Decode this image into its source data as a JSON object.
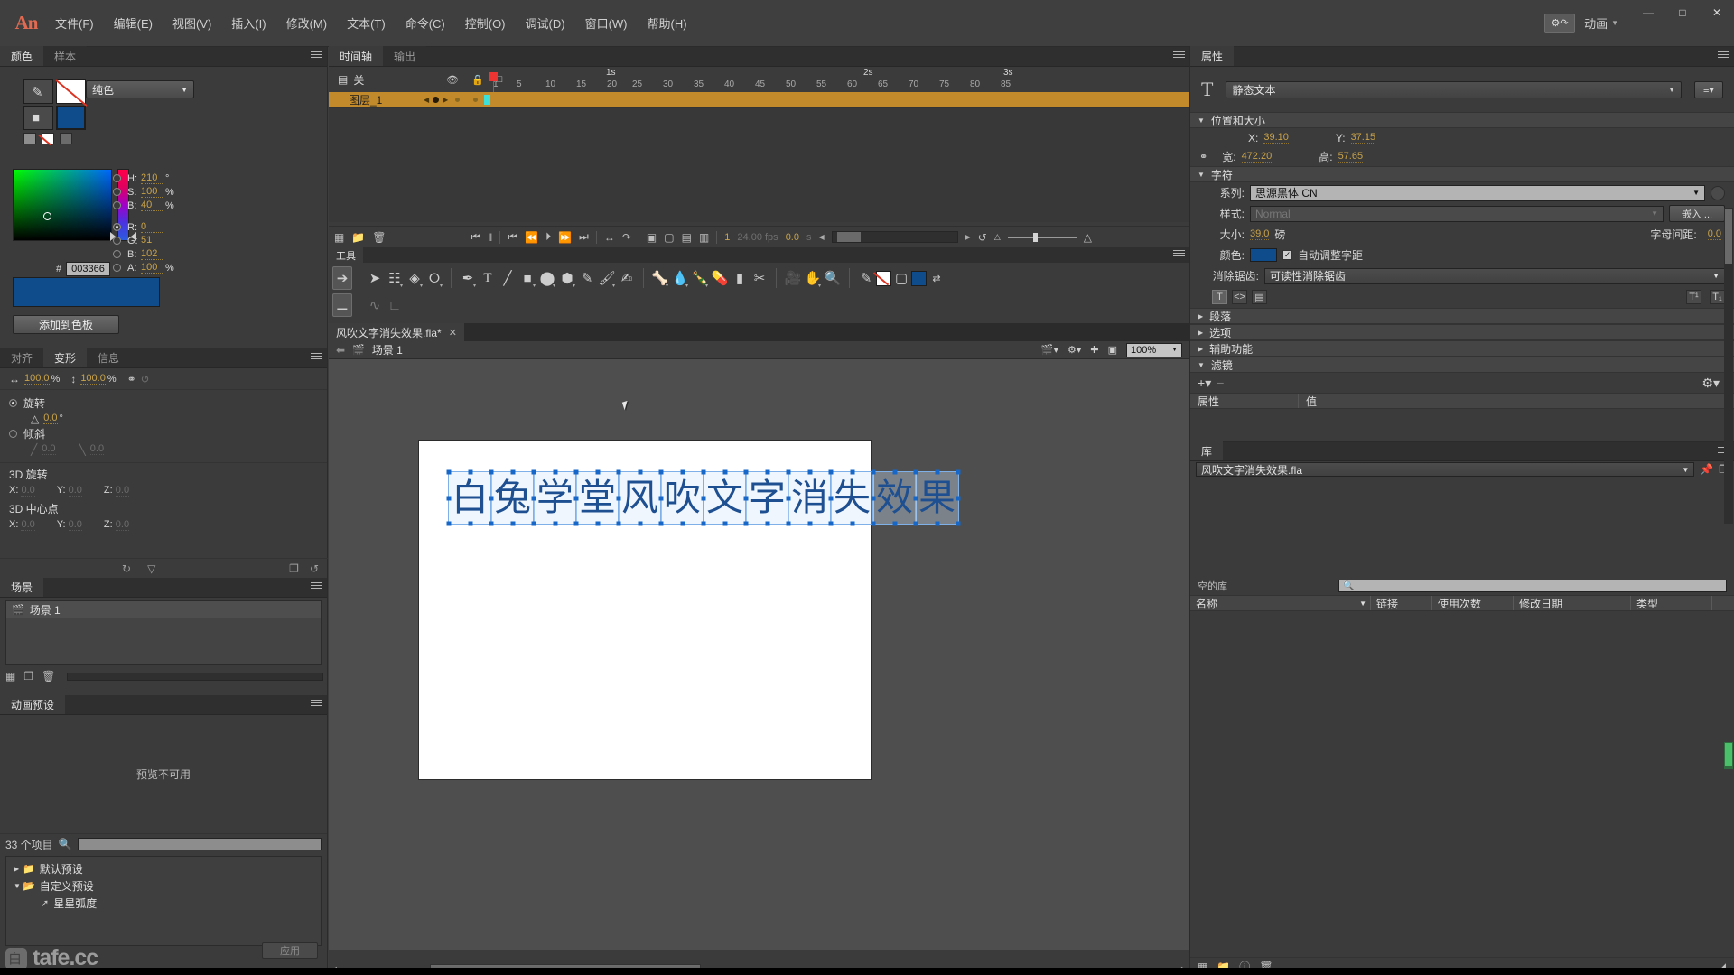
{
  "app": {
    "logo": "An",
    "menus": [
      "文件(F)",
      "编辑(E)",
      "视图(V)",
      "插入(I)",
      "修改(M)",
      "文本(T)",
      "命令(C)",
      "控制(O)",
      "调试(D)",
      "窗口(W)",
      "帮助(H)"
    ],
    "workspace_label": "动画",
    "workspace_icon": "sync-settings-icon",
    "window_buttons": {
      "minimize": "—",
      "maximize": "□",
      "close": "✕"
    }
  },
  "color_panel": {
    "tabs": [
      {
        "label": "颜色",
        "active": true
      },
      {
        "label": "样本",
        "active": false
      }
    ],
    "fill_type": "纯色",
    "hex": "003366",
    "hex_prefix": "#",
    "fields": [
      {
        "label": "H:",
        "value": "210",
        "unit": "°",
        "selected": false
      },
      {
        "label": "S:",
        "value": "100",
        "unit": "%",
        "selected": false
      },
      {
        "label": "B:",
        "value": "40",
        "unit": "%",
        "selected": false
      },
      {
        "label": "R:",
        "value": "0",
        "unit": "",
        "selected": true
      },
      {
        "label": "G:",
        "value": "51",
        "unit": "",
        "selected": false
      },
      {
        "label": "B:",
        "value": "102",
        "unit": "",
        "selected": false
      },
      {
        "label": "A:",
        "value": "100",
        "unit": "%",
        "selected": false
      }
    ],
    "add_swatch_button": "添加到色板",
    "current_color": "#0e4c8c"
  },
  "transform_panel": {
    "tabs": [
      {
        "label": "对齐",
        "active": false
      },
      {
        "label": "变形",
        "active": true
      },
      {
        "label": "信息",
        "active": false
      }
    ],
    "scale_w": "100.0",
    "scale_h": "100.0",
    "pct": "%",
    "rotate_label": "旋转",
    "rotate_value": "0.0",
    "rotate_unit": "°",
    "skew_label": "倾斜",
    "skew_x": "0.0",
    "skew_y": "0.0",
    "rot3d_label": "3D 旋转",
    "rot3d": {
      "x": "0.0",
      "y": "0.0",
      "z": "0.0"
    },
    "center3d_label": "3D 中心点",
    "center3d": {
      "x": "0.0",
      "y": "0.0",
      "z": "0.0"
    },
    "axis_labels": {
      "x": "X:",
      "y": "Y:",
      "z": "Z:"
    }
  },
  "scene_panel": {
    "tab": "场景",
    "items": [
      {
        "label": "场景 1",
        "selected": true
      }
    ]
  },
  "preset_panel": {
    "tab": "动画预设",
    "preview_text": "预览不可用",
    "item_count": "33 个项目",
    "search_placeholder": "",
    "tree": [
      {
        "label": "默认预设",
        "type": "folder",
        "expanded": false,
        "indent": 0
      },
      {
        "label": "自定义预设",
        "type": "folder",
        "expanded": true,
        "indent": 0
      },
      {
        "label": "星星弧度",
        "type": "preset",
        "indent": 1
      }
    ],
    "apply_button": "应用",
    "watermark": "tafe.cc"
  },
  "timeline": {
    "tabs": [
      {
        "label": "时间轴",
        "active": true
      },
      {
        "label": "输出",
        "active": false
      }
    ],
    "onion_label": "关",
    "ruler_seconds": [
      {
        "label": "1s",
        "frame": 24
      },
      {
        "label": "2s",
        "frame": 48
      },
      {
        "label": "3s",
        "frame": 72
      }
    ],
    "ruler_numbers": [
      1,
      5,
      10,
      15,
      20,
      25,
      30,
      35,
      40,
      45,
      50,
      55,
      60,
      65,
      70,
      75,
      80,
      85
    ],
    "layers": [
      {
        "name": "图层_1",
        "selected": true
      }
    ],
    "playhead_frame": 1,
    "current_frame": "1",
    "fps": "24.00 fps",
    "elapsed": "0.0",
    "elapsed_unit": "s"
  },
  "tools": {
    "tab": "工具",
    "selected_tool": "selection-tool",
    "items": [
      "selection-tool",
      "subselection-tool",
      "free-transform-tool",
      "lasso-tool",
      "pen-tool",
      "text-tool",
      "line-tool",
      "rectangle-tool",
      "oval-tool",
      "polystar-tool",
      "pencil-tool",
      "brush-tool",
      "paint-brush-tool",
      "bone-tool",
      "paint-bucket-tool",
      "ink-bottle-tool",
      "eyedropper-tool",
      "eraser-tool",
      "width-tool",
      "camera-tool",
      "hand-tool",
      "zoom-tool"
    ],
    "stroke_color": "#ffffff",
    "fill_color": "#0e4c8c"
  },
  "document": {
    "tab_name": "风吹文字消失效果.fla*",
    "close_glyph": "✕",
    "breadcrumb": "场景 1",
    "zoom": "100%"
  },
  "stage": {
    "characters": [
      "白",
      "兔",
      "学",
      "堂",
      "风",
      "吹",
      "文",
      "字",
      "消",
      "失",
      "效",
      "果"
    ],
    "text_color": "#1d4f91",
    "background": "#ffffff"
  },
  "properties": {
    "tab": "属性",
    "object_type": "静态文本",
    "sections": {
      "position": {
        "title": "位置和大小",
        "x_label": "X:",
        "x_value": "39.10",
        "y_label": "Y:",
        "y_value": "37.15",
        "w_label": "宽:",
        "w_value": "472.20",
        "h_label": "高:",
        "h_value": "57.65"
      },
      "character": {
        "title": "字符",
        "family_label": "系列:",
        "family_value": "思源黑体 CN",
        "style_label": "样式:",
        "style_value": "Normal",
        "embed_button": "嵌入 ...",
        "size_label": "大小:",
        "size_value": "39.0",
        "size_unit": "磅",
        "letterspacing_label": "字母间距:",
        "letterspacing_value": "0.0",
        "color_label": "颜色:",
        "color_value": "#0e4c8c",
        "autokern_label": "自动调整字距",
        "autokern_checked": true,
        "antialias_label": "消除锯齿:",
        "antialias_value": "可读性消除锯齿"
      },
      "collapsed": [
        {
          "title": "段落"
        },
        {
          "title": "选项"
        },
        {
          "title": "辅助功能"
        }
      ],
      "filters": {
        "title": "滤镜",
        "add_glyph": "+",
        "remove_glyph": "−",
        "columns": [
          "属性",
          "值"
        ]
      }
    }
  },
  "library": {
    "tab": "库",
    "document_name": "风吹文字消失效果.fla",
    "status": "空的库",
    "search_placeholder": "",
    "columns": [
      "名称",
      "链接",
      "使用次数",
      "修改日期",
      "类型"
    ]
  }
}
